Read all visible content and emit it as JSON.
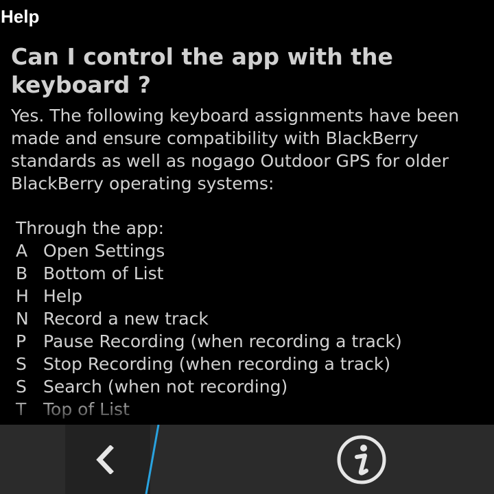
{
  "title_bar": {
    "title": "Help"
  },
  "main": {
    "question": "Can I control the app with the keyboard ?",
    "answer": "Yes. The following keyboard assignments have been made and ensure compatibility with BlackBerry standards as well as nogago Outdoor GPS for older BlackBerry operating systems:",
    "section_label": "Through the app:",
    "shortcuts": [
      {
        "key": "A",
        "action": "Open Settings"
      },
      {
        "key": "B",
        "action": "Bottom of List"
      },
      {
        "key": "H",
        "action": "Help"
      },
      {
        "key": "N",
        "action": "Record a new track"
      },
      {
        "key": "P",
        "action": "Pause Recording (when recording a track)"
      },
      {
        "key": "S",
        "action": "Stop Recording (when recording a track)"
      },
      {
        "key": "S",
        "action": "Search (when not recording)"
      },
      {
        "key": "T",
        "action": "Top of List"
      }
    ]
  },
  "action_bar": {
    "back_icon": "chevron-left-icon",
    "info_icon": "info-icon",
    "accent_color": "#29a3e0"
  }
}
